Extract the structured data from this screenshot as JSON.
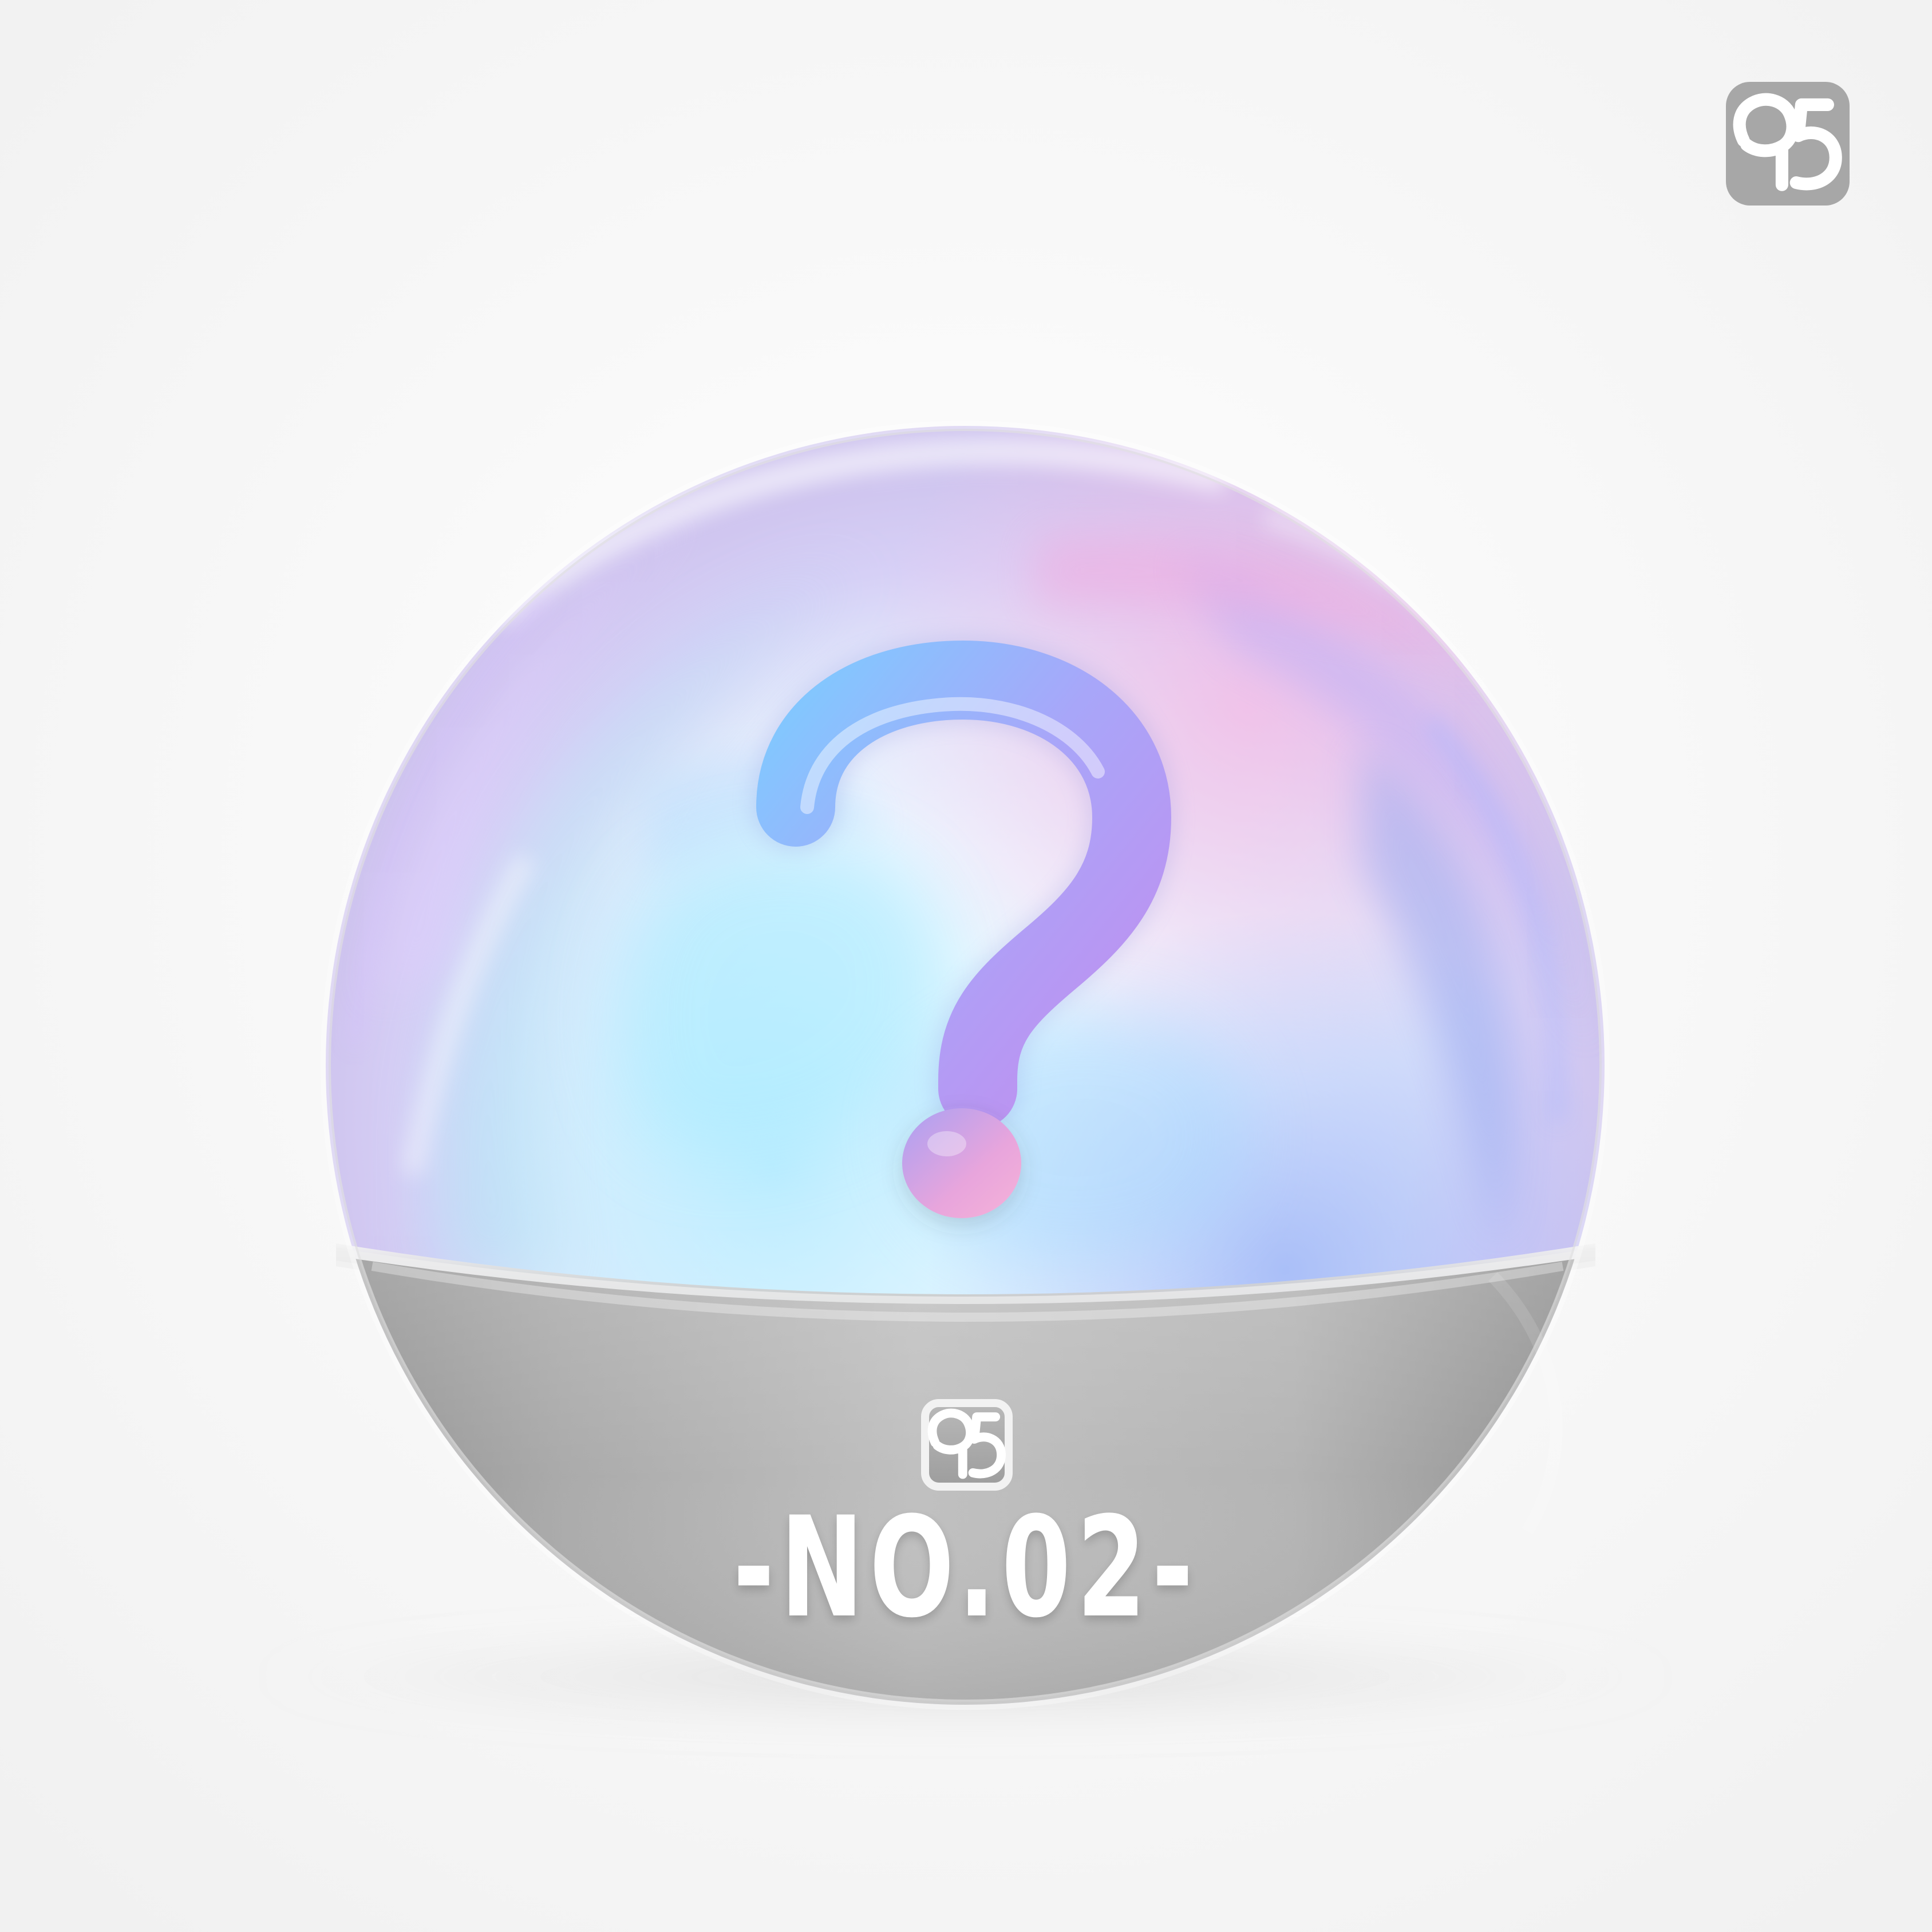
{
  "capsule": {
    "number_label": "-NO.02-",
    "content_icon": "question-mark-icon",
    "brand_icon": "logo-95-icon"
  },
  "corner_badge": {
    "icon": "logo-95-icon"
  },
  "colors": {
    "background": "#f6f6f6",
    "base_silver": "#b2b2b2",
    "logo_tile": "#a7a7a7",
    "question_blue": "#88c8ff",
    "question_violet": "#b29af5",
    "question_pink": "#f2a8dc"
  }
}
